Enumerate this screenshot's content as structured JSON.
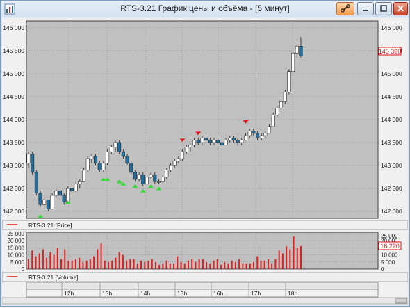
{
  "window": {
    "title": "RTS-3.21 График цены и объёма - [5 минут]"
  },
  "price_panel": {
    "y_ticks": [
      "146 000",
      "145 500",
      "145 000",
      "144 500",
      "144 000",
      "143 500",
      "143 000",
      "142 500",
      "142 000"
    ],
    "y_tick_values": [
      146000,
      145500,
      145000,
      144500,
      144000,
      143500,
      143000,
      142500,
      142000
    ],
    "current_label": "145 390",
    "legend": "RTS-3.21 [Price]"
  },
  "volume_panel": {
    "y_ticks": [
      "25 000",
      "20 000",
      "15 000",
      "10 000",
      "5 000",
      "0"
    ],
    "y_tick_values": [
      25000,
      20000,
      15000,
      10000,
      5000,
      0
    ],
    "current_label": "16 220",
    "legend": "RTS-3.21 [Volume]"
  },
  "time_axis": {
    "labels": [
      "12h",
      "13h",
      "14h",
      "15h",
      "16h",
      "17h",
      "18h"
    ]
  },
  "colors": {
    "bull": "#ffffff",
    "bear": "#1f6fa3",
    "volume": "#e02020",
    "sell_marker": "#e01818",
    "buy_marker": "#33dd33",
    "current_label": "#e01010",
    "grid": "#8a8a8a",
    "panel_bg": "#c0c0c0"
  },
  "chart_data": [
    {
      "type": "candlestick",
      "name": "RTS-3.21 [Price]",
      "ylim": [
        141850,
        146150
      ],
      "x_labels": [
        "12h",
        "13h",
        "14h",
        "15h",
        "16h",
        "17h",
        "18h"
      ],
      "candles": [
        [
          143050,
          143300,
          142950,
          143250
        ],
        [
          143250,
          143300,
          142800,
          142850
        ],
        [
          142850,
          142900,
          142350,
          142400
        ],
        [
          142400,
          142450,
          142100,
          142150
        ],
        [
          142150,
          142300,
          142050,
          142250
        ],
        [
          142250,
          142250,
          142000,
          142050
        ],
        [
          142050,
          142400,
          142050,
          142350
        ],
        [
          142350,
          142500,
          142300,
          142450
        ],
        [
          142450,
          142550,
          142300,
          142350
        ],
        [
          142350,
          142400,
          142150,
          142200
        ],
        [
          142200,
          142550,
          142200,
          142500
        ],
        [
          142500,
          142600,
          142350,
          142450
        ],
        [
          142450,
          142650,
          142400,
          142600
        ],
        [
          142600,
          142700,
          142500,
          142650
        ],
        [
          142650,
          142950,
          142650,
          142900
        ],
        [
          142900,
          143200,
          142850,
          143150
        ],
        [
          143150,
          143250,
          143050,
          143200
        ],
        [
          143200,
          143250,
          143000,
          143050
        ],
        [
          143050,
          143100,
          142850,
          142900
        ],
        [
          142900,
          143100,
          142850,
          143050
        ],
        [
          143050,
          143350,
          143000,
          143300
        ],
        [
          143300,
          143450,
          143250,
          143400
        ],
        [
          143400,
          143550,
          143300,
          143500
        ],
        [
          143500,
          143550,
          143250,
          143300
        ],
        [
          143300,
          143350,
          143150,
          143200
        ],
        [
          143200,
          143250,
          143000,
          143050
        ],
        [
          143050,
          143100,
          142800,
          142850
        ],
        [
          142850,
          142900,
          142650,
          142700
        ],
        [
          142700,
          142850,
          142650,
          142800
        ],
        [
          142800,
          142850,
          142550,
          142600
        ],
        [
          142600,
          142800,
          142600,
          142750
        ],
        [
          142750,
          142850,
          142700,
          142800
        ],
        [
          142800,
          142850,
          142600,
          142650
        ],
        [
          142650,
          142700,
          142600,
          142650
        ],
        [
          142650,
          142800,
          142650,
          142750
        ],
        [
          142750,
          142950,
          142700,
          142900
        ],
        [
          142900,
          143050,
          142850,
          143000
        ],
        [
          143000,
          143150,
          142950,
          143100
        ],
        [
          143100,
          143200,
          143050,
          143150
        ],
        [
          143150,
          143350,
          143100,
          143300
        ],
        [
          143300,
          143450,
          143250,
          143400
        ],
        [
          143400,
          143500,
          143300,
          143450
        ],
        [
          143450,
          143600,
          143400,
          143550
        ],
        [
          143550,
          143600,
          143450,
          143500
        ],
        [
          143500,
          143650,
          143450,
          143600
        ],
        [
          143600,
          143650,
          143500,
          143550
        ],
        [
          143550,
          143600,
          143450,
          143500
        ],
        [
          143500,
          143600,
          143450,
          143550
        ],
        [
          143550,
          143600,
          143450,
          143500
        ],
        [
          143500,
          143550,
          143400,
          143450
        ],
        [
          143450,
          143600,
          143450,
          143550
        ],
        [
          143550,
          143650,
          143500,
          143600
        ],
        [
          143600,
          143650,
          143500,
          143550
        ],
        [
          143550,
          143600,
          143450,
          143500
        ],
        [
          143500,
          143600,
          143450,
          143550
        ],
        [
          143550,
          143700,
          143550,
          143650
        ],
        [
          143650,
          143800,
          143600,
          143750
        ],
        [
          143750,
          143800,
          143650,
          143700
        ],
        [
          143700,
          143750,
          143550,
          143600
        ],
        [
          143600,
          143700,
          143550,
          143650
        ],
        [
          143650,
          143750,
          143600,
          143700
        ],
        [
          143700,
          143900,
          143700,
          143850
        ],
        [
          143850,
          144150,
          143850,
          144100
        ],
        [
          144100,
          144300,
          144050,
          144250
        ],
        [
          144250,
          144450,
          144200,
          144400
        ],
        [
          144400,
          144650,
          144350,
          144600
        ],
        [
          144600,
          145100,
          144550,
          145050
        ],
        [
          145050,
          145500,
          145000,
          145450
        ],
        [
          145450,
          145650,
          145350,
          145600
        ],
        [
          145600,
          145800,
          145350,
          145390
        ]
      ]
    },
    {
      "type": "bar",
      "name": "RTS-3.21 [Volume]",
      "ylim": [
        0,
        25000
      ],
      "values": [
        7000,
        13000,
        9000,
        11000,
        14000,
        8000,
        12000,
        10000,
        15000,
        7000,
        14000,
        6000,
        6000,
        7000,
        8000,
        5000,
        6000,
        7000,
        9000,
        14000,
        18000,
        6000,
        5000,
        6000,
        8000,
        12000,
        10000,
        6000,
        7000,
        7000,
        4000,
        6000,
        5000,
        6000,
        7000,
        5000,
        3000,
        4000,
        6000,
        4000,
        4000,
        9000,
        5000,
        4000,
        6000,
        7000,
        5000,
        7000,
        7000,
        5000,
        4000,
        6000,
        7000,
        3000,
        5000,
        4000,
        6000,
        5000,
        7000,
        4000,
        4000,
        4000,
        5000,
        9000,
        6000,
        6000,
        7000,
        4000,
        7000,
        13000,
        11000,
        16000,
        14000,
        23000,
        15000,
        16220
      ]
    }
  ]
}
